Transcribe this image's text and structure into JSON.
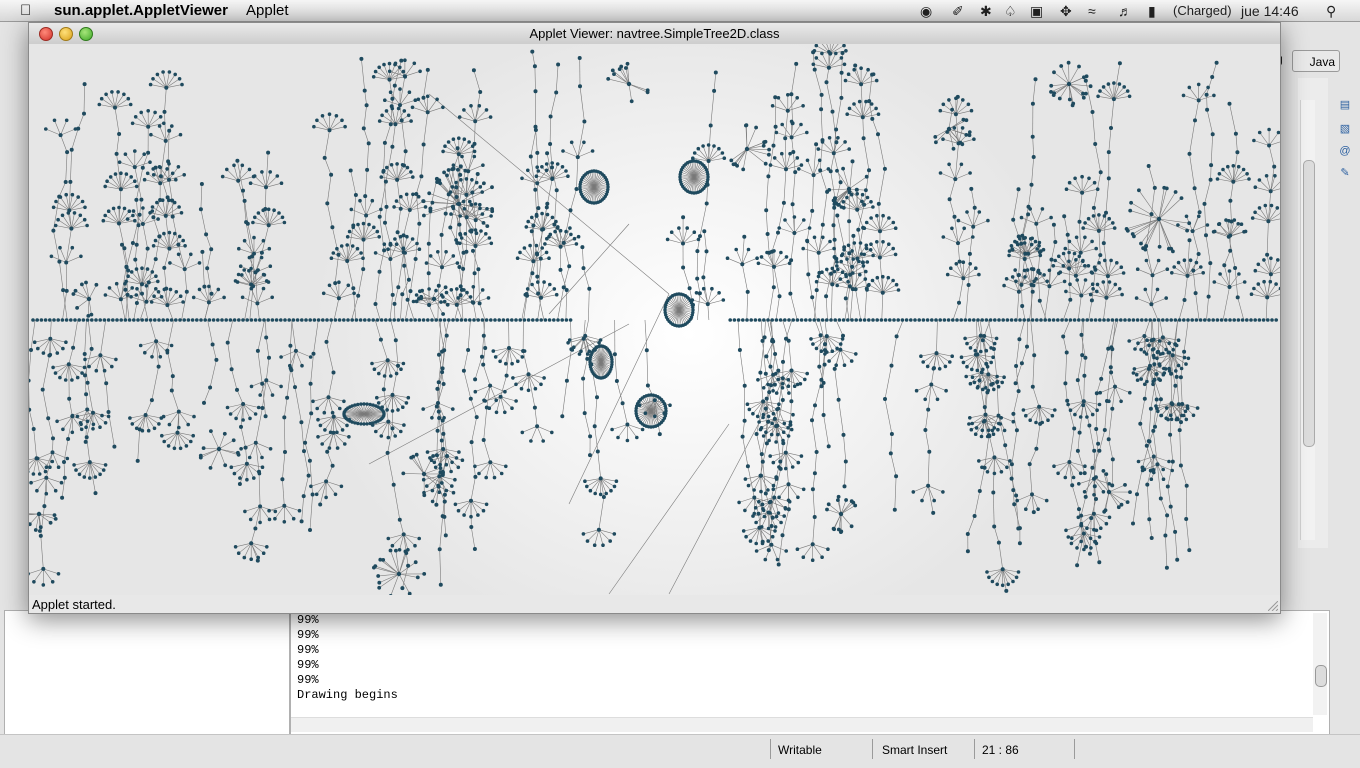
{
  "menubar": {
    "app_name": "sun.applet.AppletViewer",
    "menu_applet": "Applet",
    "battery": "(Charged)",
    "clock": "jue 14:46"
  },
  "applet_window": {
    "title": "Applet Viewer: navtree.SimpleTree2D.class",
    "status": "Applet started."
  },
  "eclipse": {
    "perspective_java": "Java",
    "perspective_partial": "g",
    "console_lines": [
      "99%",
      "99%",
      "99%",
      "99%",
      "99%",
      "Drawing begins"
    ],
    "status_writable": "Writable",
    "status_insert": "Smart Insert",
    "status_position": "21 : 86"
  },
  "colors": {
    "node": "#1f4a5e",
    "edge": "#7a7a7a",
    "accent_close": "#d0302a",
    "accent_min": "#d8a019",
    "accent_zoom": "#3fa828"
  },
  "icons": [
    "apple-icon",
    "wifi-icon",
    "volume-icon",
    "battery-icon",
    "bluetooth-icon",
    "search-icon"
  ]
}
